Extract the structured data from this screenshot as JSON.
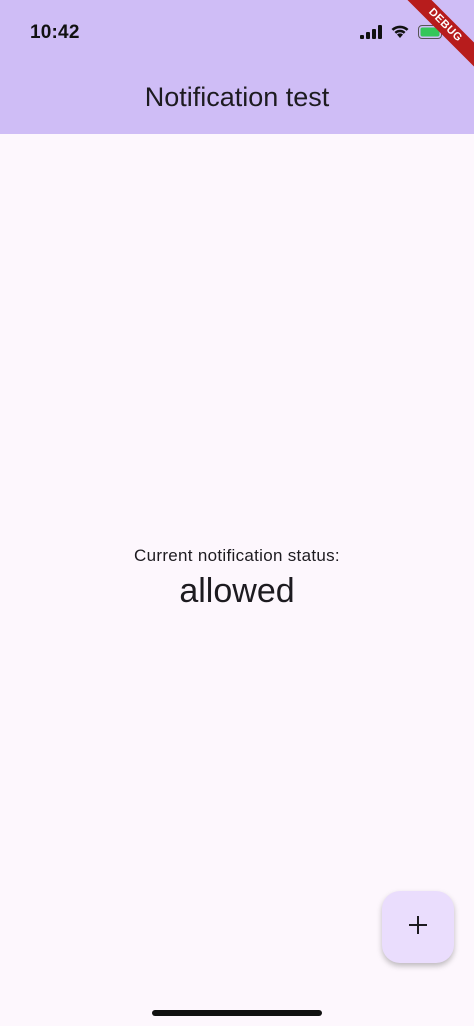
{
  "status_bar": {
    "time": "10:42",
    "icons": [
      "signal-icon",
      "wifi-icon",
      "battery-icon"
    ]
  },
  "app_bar": {
    "title": "Notification test",
    "background_color": "#cfbdf6"
  },
  "debug_banner": {
    "label": "DEBUG",
    "color": "#b71c1c"
  },
  "body": {
    "status_label": "Current notification status:",
    "status_value": "allowed",
    "background_color": "#fdf7fd"
  },
  "fab": {
    "icon": "plus-icon",
    "background_color": "#eaddfd"
  }
}
